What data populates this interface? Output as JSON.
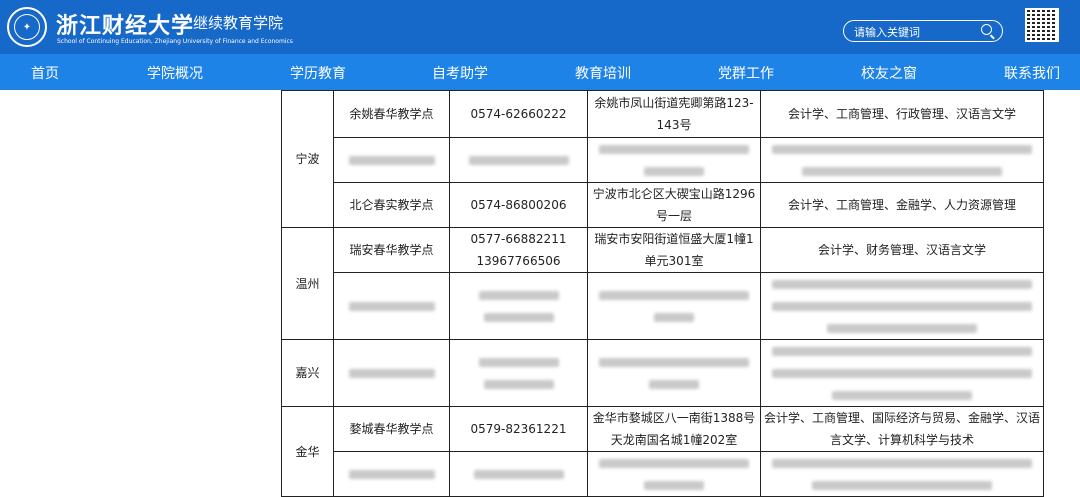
{
  "header": {
    "logo_title": "浙江财经大学",
    "logo_subtitle": "继续教育学院",
    "logo_en": "School of Continuing Education, Zhejiang University of Finance and Economics",
    "search_placeholder": "请输入关键词",
    "colors": {
      "header_bg": "#1668c9",
      "nav_bg": "#1e83e6"
    }
  },
  "nav": {
    "items": [
      "首页",
      "学院概况",
      "学历教育",
      "自考助学",
      "教育培训",
      "党群工作",
      "校友之窗",
      "联系我们"
    ]
  },
  "table": {
    "rows": [
      {
        "city": "宁波",
        "name": "余姚春华教学点",
        "phone": "0574-62660222",
        "address": "余姚市凤山街道宪卿第路123-143号",
        "majors": "会计学、工商管理、行政管理、汉语言文学"
      },
      {
        "city": "",
        "name": "",
        "phone": "",
        "address": "",
        "majors": "",
        "blurred": true
      },
      {
        "city": "",
        "name": "北仑春实教学点",
        "phone": "0574-86800206",
        "address": "宁波市北仑区大碶宝山路1296号一层",
        "majors": "会计学、工商管理、金融学、人力资源管理"
      },
      {
        "city": "温州",
        "name": "瑞安春华教学点",
        "phone_line1": "0577-66882211",
        "phone_line2": "13967766506",
        "address": "瑞安市安阳街道恒盛大厦1幢1单元301室",
        "majors": "会计学、财务管理、汉语言文学"
      },
      {
        "city": "",
        "blurred": true
      },
      {
        "city": "嘉兴",
        "blurred": true
      },
      {
        "city": "金华",
        "name": "婺城春华教学点",
        "phone": "0579-82361221",
        "address": "金华市婺城区八一南街1388号天龙南国名城1幢202室",
        "majors": "会计学、工商管理、国际经济与贸易、金融学、汉语言文学、计算机科学与技术"
      },
      {
        "city": "",
        "blurred": true
      }
    ]
  }
}
